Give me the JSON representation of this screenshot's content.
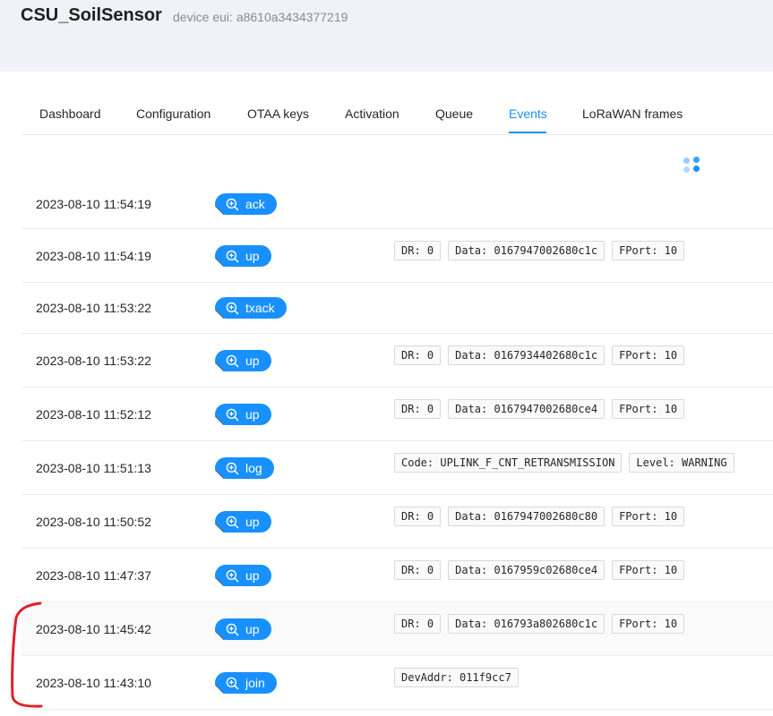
{
  "header": {
    "device_name": "CSU_SoilSensor",
    "device_eui": "device eui: a8610a3434377219"
  },
  "tabs": [
    {
      "label": "Dashboard",
      "active": false
    },
    {
      "label": "Configuration",
      "active": false
    },
    {
      "label": "OTAA keys",
      "active": false
    },
    {
      "label": "Activation",
      "active": false
    },
    {
      "label": "Queue",
      "active": false
    },
    {
      "label": "Events",
      "active": true
    },
    {
      "label": "LoRaWAN frames",
      "active": false
    }
  ],
  "colors": {
    "accent": "#1890ff",
    "annotation": "#e0202a"
  },
  "events": [
    {
      "time": "2023-08-10 11:54:19",
      "type": "ack",
      "tags": []
    },
    {
      "time": "2023-08-10 11:54:19",
      "type": "up",
      "tags": [
        "DR: 0",
        "Data: 0167947002680c1c",
        "FPort: 10"
      ]
    },
    {
      "time": "2023-08-10 11:53:22",
      "type": "txack",
      "tags": []
    },
    {
      "time": "2023-08-10 11:53:22",
      "type": "up",
      "tags": [
        "DR: 0",
        "Data: 0167934402680c1c",
        "FPort: 10"
      ]
    },
    {
      "time": "2023-08-10 11:52:12",
      "type": "up",
      "tags": [
        "DR: 0",
        "Data: 0167947002680ce4",
        "FPort: 10"
      ]
    },
    {
      "time": "2023-08-10 11:51:13",
      "type": "log",
      "tags": [
        "Code: UPLINK_F_CNT_RETRANSMISSION",
        "Level: WARNING"
      ]
    },
    {
      "time": "2023-08-10 11:50:52",
      "type": "up",
      "tags": [
        "DR: 0",
        "Data: 0167947002680c80",
        "FPort: 10"
      ]
    },
    {
      "time": "2023-08-10 11:47:37",
      "type": "up",
      "tags": [
        "DR: 0",
        "Data: 0167959c02680ce4",
        "FPort: 10"
      ]
    },
    {
      "time": "2023-08-10 11:45:42",
      "type": "up",
      "tags": [
        "DR: 0",
        "Data: 016793a802680c1c",
        "FPort: 10"
      ],
      "highlighted": true
    },
    {
      "time": "2023-08-10 11:43:10",
      "type": "join",
      "tags": [
        "DevAddr: 011f9cc7"
      ]
    }
  ]
}
